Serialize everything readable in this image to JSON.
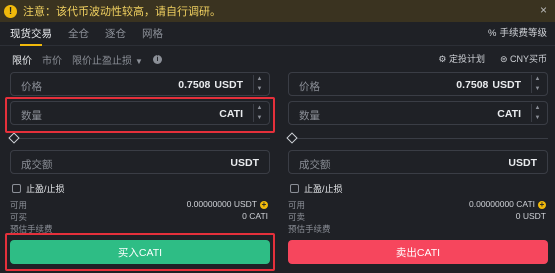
{
  "banner": {
    "text": "注意：该代币波动性较高，请自行调研。",
    "close": "×"
  },
  "tabs": [
    {
      "label": "现货交易"
    },
    {
      "label": "全仓"
    },
    {
      "label": "逐仓"
    },
    {
      "label": "网格"
    }
  ],
  "fee_tier": "手续费等级",
  "order_types": {
    "limit": "限价",
    "market": "市价",
    "stop": "限价止盈止损"
  },
  "right_links": {
    "dca": "定投计划",
    "buy_cny": "CNY买币"
  },
  "buy": {
    "price": {
      "label": "价格",
      "value": "0.7508",
      "unit": "USDT"
    },
    "amount": {
      "label": "数量",
      "unit": "CATI"
    },
    "total": {
      "label": "成交额",
      "unit": "USDT"
    },
    "tpsl": "止盈/止损",
    "available_label": "可用",
    "available_value": "0.00000000 USDT",
    "max_label": "可买",
    "max_value": "0 CATI",
    "fee_label": "预估手续费",
    "button": "买入CATI"
  },
  "sell": {
    "price": {
      "label": "价格",
      "value": "0.7508",
      "unit": "USDT"
    },
    "amount": {
      "label": "数量",
      "unit": "CATI"
    },
    "total": {
      "label": "成交额",
      "unit": "USDT"
    },
    "tpsl": "止盈/止损",
    "available_label": "可用",
    "available_value": "0.00000000 CATI",
    "max_label": "可卖",
    "max_value": "0 USDT",
    "fee_label": "预估手续费",
    "button": "卖出CATI"
  },
  "colors": {
    "buy": "#2ebd85",
    "sell": "#f6465d",
    "accent": "#f0b90b",
    "highlight": "#e5303b"
  }
}
